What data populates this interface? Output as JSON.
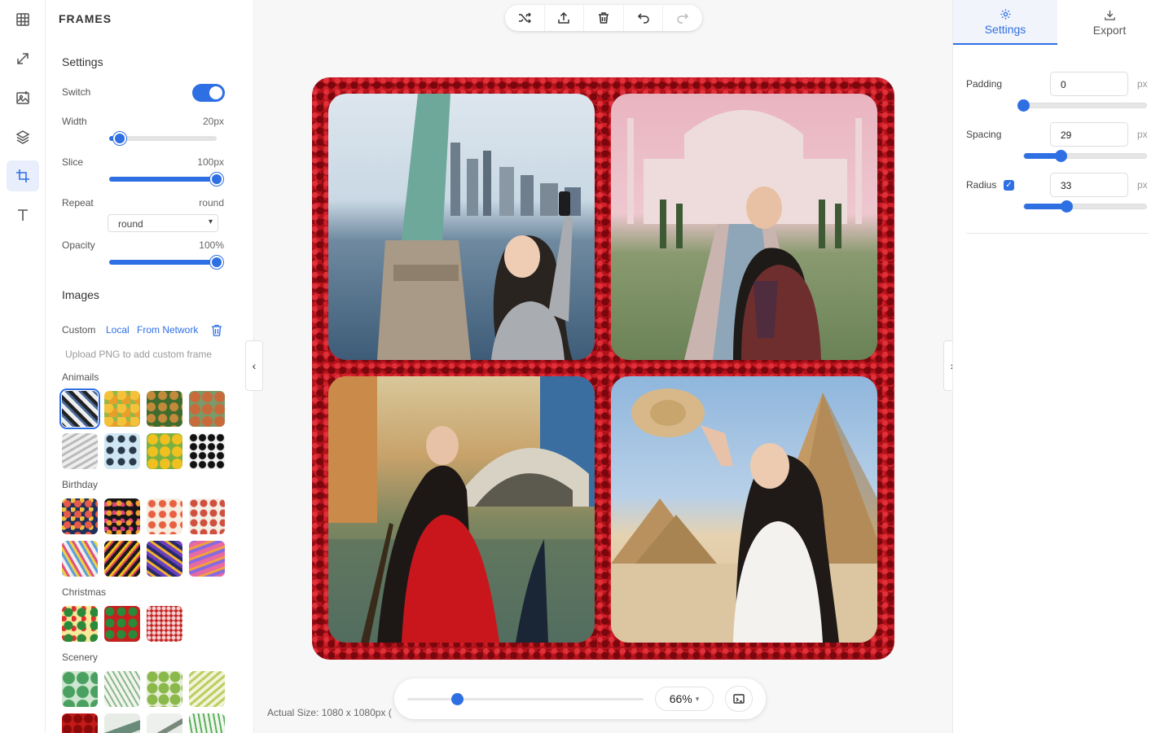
{
  "rail": [
    "grid-icon",
    "resize-icon",
    "image-add-icon",
    "layers-icon",
    "crop-icon",
    "text-icon"
  ],
  "panel": {
    "title": "FRAMES",
    "settings": {
      "title": "Settings",
      "switch_label": "Switch",
      "switch_on": true,
      "width_label": "Width",
      "width_value": "20px",
      "width_level": 0.1,
      "slice_label": "Slice",
      "slice_value": "100px",
      "slice_level": 1.0,
      "repeat_label": "Repeat",
      "repeat_value": "round",
      "repeat_select": "round",
      "opacity_label": "Opacity",
      "opacity_value": "100%",
      "opacity_level": 1.0
    },
    "images": {
      "title": "Images",
      "custom": "Custom",
      "local": "Local",
      "network": "From Network",
      "hint": "Upload PNG to add custom frame",
      "categories": [
        {
          "name": "Animails",
          "count": 8
        },
        {
          "name": "Birthday",
          "count": 8
        },
        {
          "name": "Christmas",
          "count": 3
        },
        {
          "name": "Scenery",
          "count": 8
        }
      ]
    }
  },
  "toolbar": [
    "shuffle-icon",
    "upload-icon",
    "trash-icon",
    "undo-icon",
    "redo-icon"
  ],
  "zoom": {
    "label": "66%",
    "actual_size": "Actual Size: 1080 x 1080px (",
    "level": 0.21
  },
  "right": {
    "tabs": [
      {
        "label": "Settings",
        "icon": "gear-icon",
        "active": true
      },
      {
        "label": "Export",
        "icon": "download-icon",
        "active": false
      }
    ],
    "padding_label": "Padding",
    "padding_value": "0",
    "padding_level": 0.0,
    "spacing_label": "Spacing",
    "spacing_value": "29",
    "spacing_level": 0.3,
    "radius_label": "Radius",
    "radius_value": "33",
    "radius_level": 0.35,
    "radius_checked": true,
    "unit": "px"
  },
  "colors": {
    "accent": "#2f6fe4",
    "frame": "#b4121b"
  }
}
